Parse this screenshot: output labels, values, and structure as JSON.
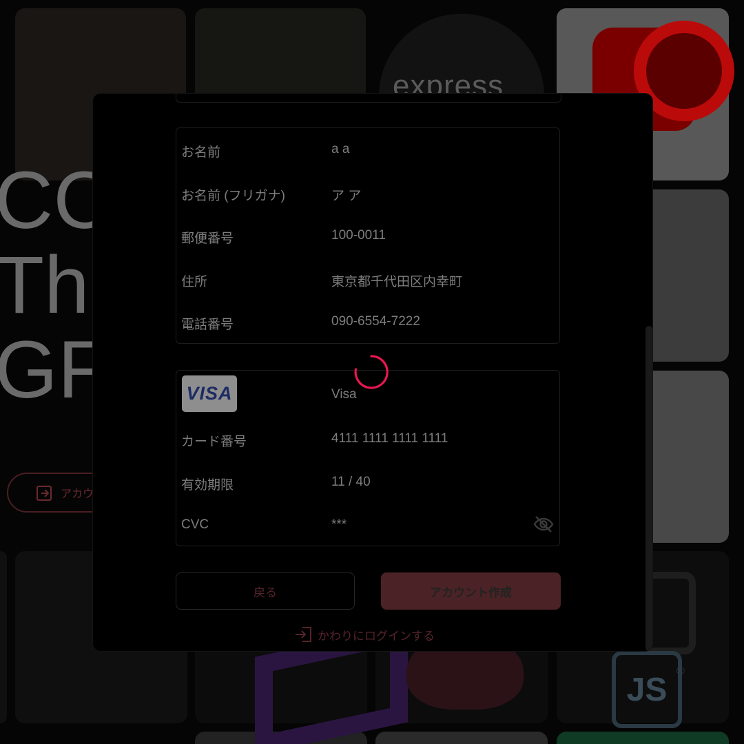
{
  "background": {
    "tile_text": "express",
    "big_text_lines": [
      "CC",
      "The",
      "GF"
    ],
    "pill_label": "アカウ",
    "js_label": "JS",
    "js_reg": "®"
  },
  "personal_info": {
    "rows": [
      {
        "label": "お名前",
        "value": "a a"
      },
      {
        "label": "お名前 (フリガナ)",
        "value": "ア ア"
      },
      {
        "label": "郵便番号",
        "value": "100-0011"
      },
      {
        "label": "住所",
        "value": "東京都千代田区内幸町"
      },
      {
        "label": "電話番号",
        "value": "090-6554-7222"
      }
    ]
  },
  "card_info": {
    "brand_badge": "VISA",
    "brand_name": "Visa",
    "rows": [
      {
        "label": "カード番号",
        "value": "4111 1111 1111 1111"
      },
      {
        "label": "有効期限",
        "value": "11 / 40"
      },
      {
        "label": "CVC",
        "value": "***"
      }
    ],
    "cvc_visibility_icon": "eye-off-icon"
  },
  "actions": {
    "back_label": "戻る",
    "create_label": "アカウント作成",
    "login_label": "かわりにログインする"
  },
  "colors": {
    "accent": "#e8174f",
    "primary_button_dimmed": "#4b2225"
  }
}
